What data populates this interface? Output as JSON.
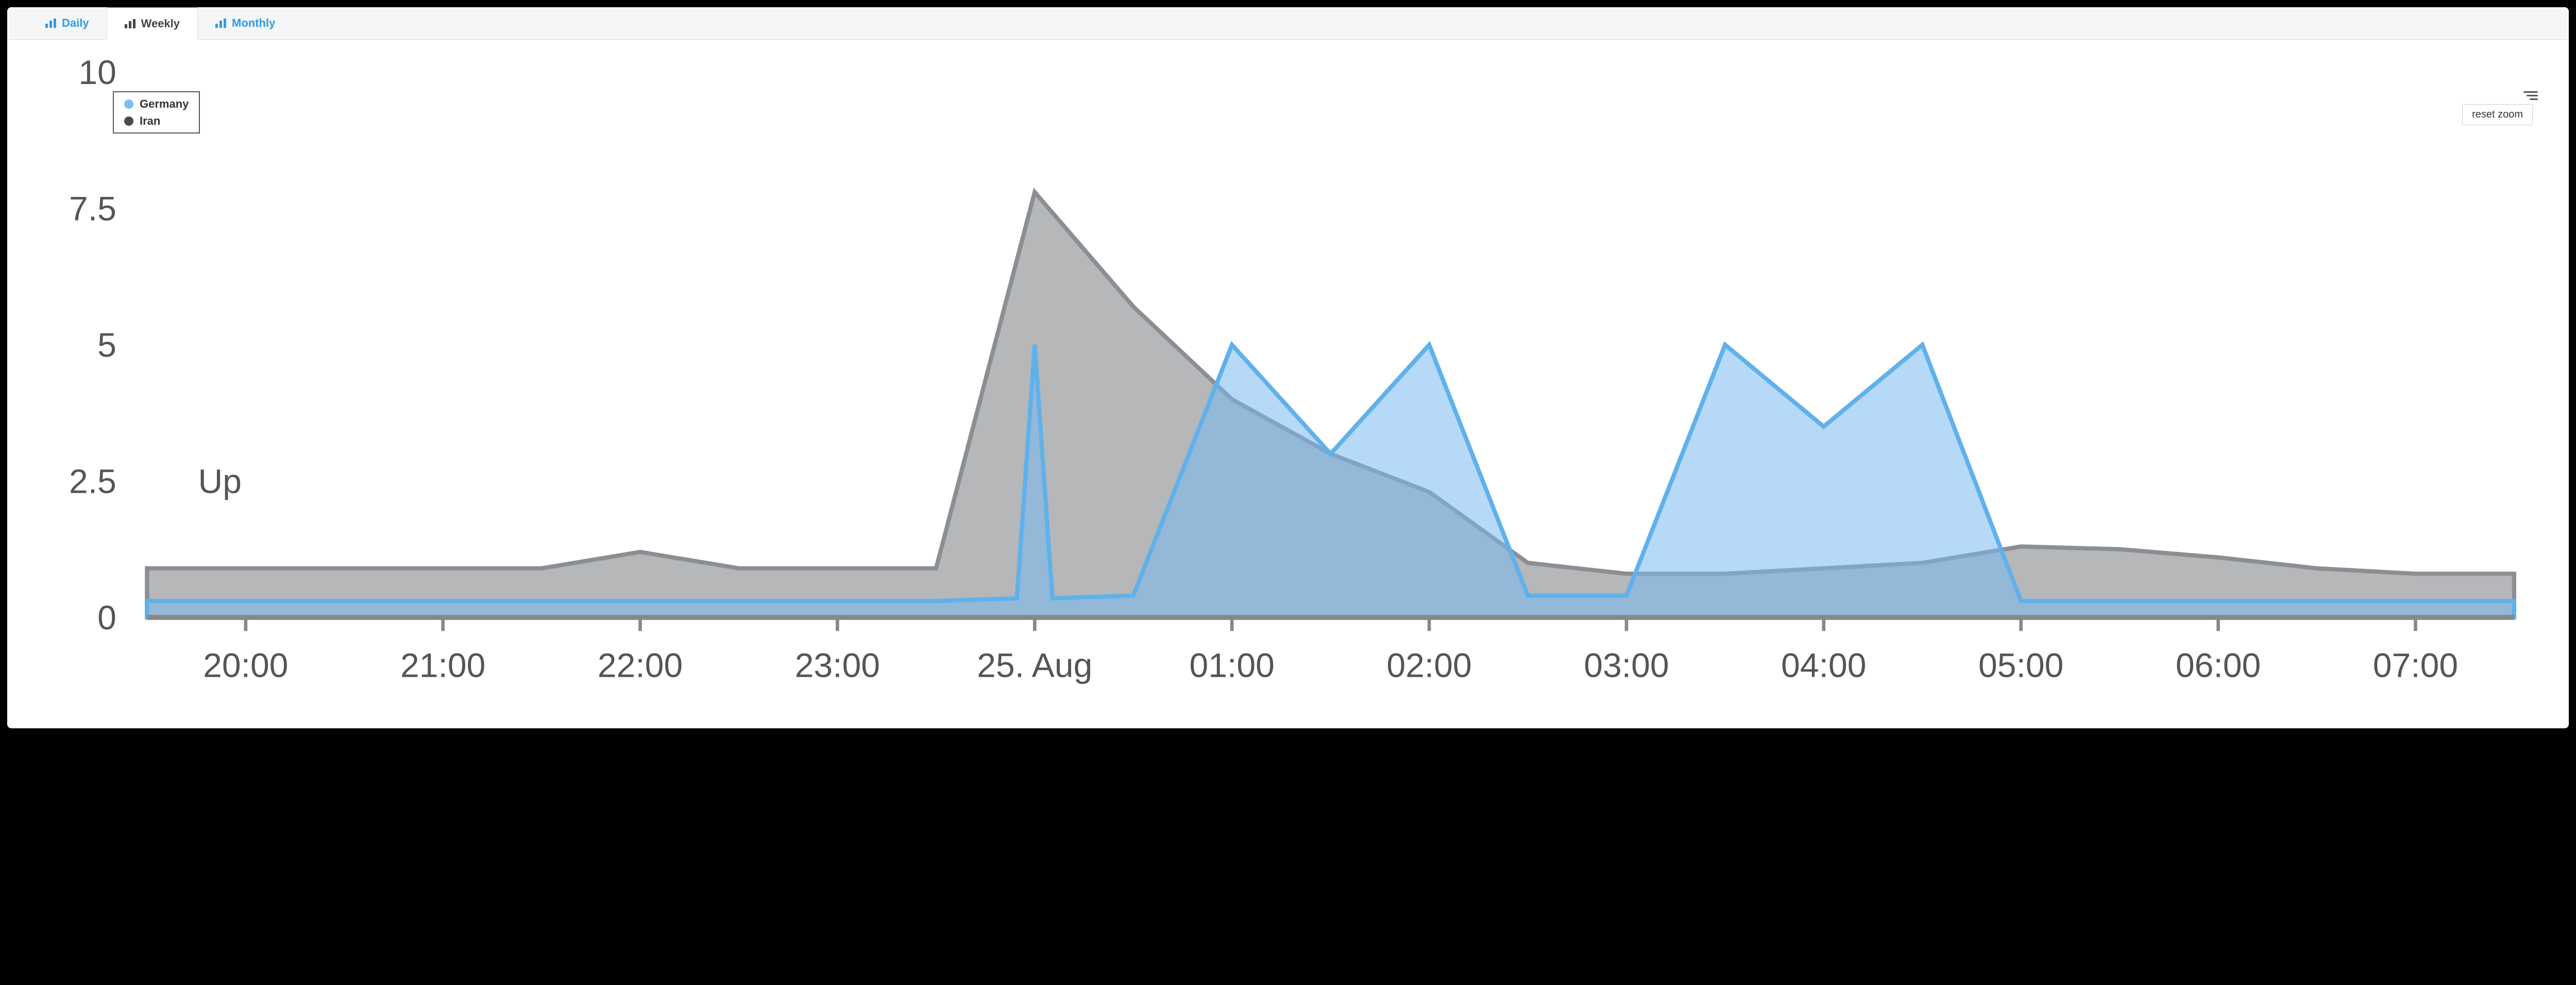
{
  "tabs": {
    "items": [
      {
        "label": "Daily"
      },
      {
        "label": "Weekly"
      },
      {
        "label": "Monthly"
      }
    ],
    "active_index": 1
  },
  "legend": {
    "items": [
      {
        "label": "Germany",
        "color": "#7cbff2"
      },
      {
        "label": "Iran",
        "color": "#4a4a4a"
      }
    ]
  },
  "buttons": {
    "reset_zoom": "reset zoom"
  },
  "axis": {
    "ylabel": "Up"
  },
  "chart_data": {
    "type": "area",
    "xlabel": "",
    "ylabel": "Up",
    "ylim": [
      0,
      10
    ],
    "yticks": [
      0,
      2.5,
      5,
      7.5,
      10
    ],
    "categories": [
      "19:30",
      "20:00",
      "20:30",
      "21:00",
      "21:30",
      "22:00",
      "22:30",
      "23:00",
      "23:30",
      "25. Aug",
      "00:30",
      "01:00",
      "01:30",
      "02:00",
      "02:30",
      "03:00",
      "03:30",
      "04:00",
      "04:30",
      "05:00",
      "05:30",
      "06:00",
      "06:30",
      "07:00",
      "07:30"
    ],
    "xtick_labels": [
      "20:00",
      "21:00",
      "22:00",
      "23:00",
      "25. Aug",
      "01:00",
      "02:00",
      "03:00",
      "04:00",
      "05:00",
      "06:00",
      "07:00"
    ],
    "xtick_indices": [
      1,
      3,
      5,
      7,
      9,
      11,
      13,
      15,
      17,
      19,
      21,
      23
    ],
    "series": [
      {
        "name": "Iran",
        "color": "#8b8f93",
        "fill": "rgba(120,124,128,0.55)",
        "values": [
          0.9,
          0.9,
          0.9,
          0.9,
          0.9,
          1.2,
          0.9,
          0.9,
          0.9,
          7.8,
          5.7,
          4.0,
          3.0,
          2.3,
          1.0,
          0.8,
          0.8,
          0.9,
          1.0,
          1.3,
          1.25,
          1.1,
          0.9,
          0.8,
          0.8
        ]
      },
      {
        "name": "Germany",
        "color": "#5fb1ec",
        "fill": "rgba(120,185,240,0.55)",
        "values": [
          0.3,
          0.3,
          0.3,
          0.3,
          0.3,
          0.3,
          0.3,
          0.3,
          0.3,
          5.0,
          0.4,
          5.0,
          3.0,
          5.0,
          0.4,
          0.4,
          5.0,
          3.5,
          5.0,
          0.3,
          0.3,
          0.3,
          0.3,
          0.3,
          0.3
        ]
      }
    ],
    "title": "",
    "legend_position": "top-left",
    "grid": false
  }
}
